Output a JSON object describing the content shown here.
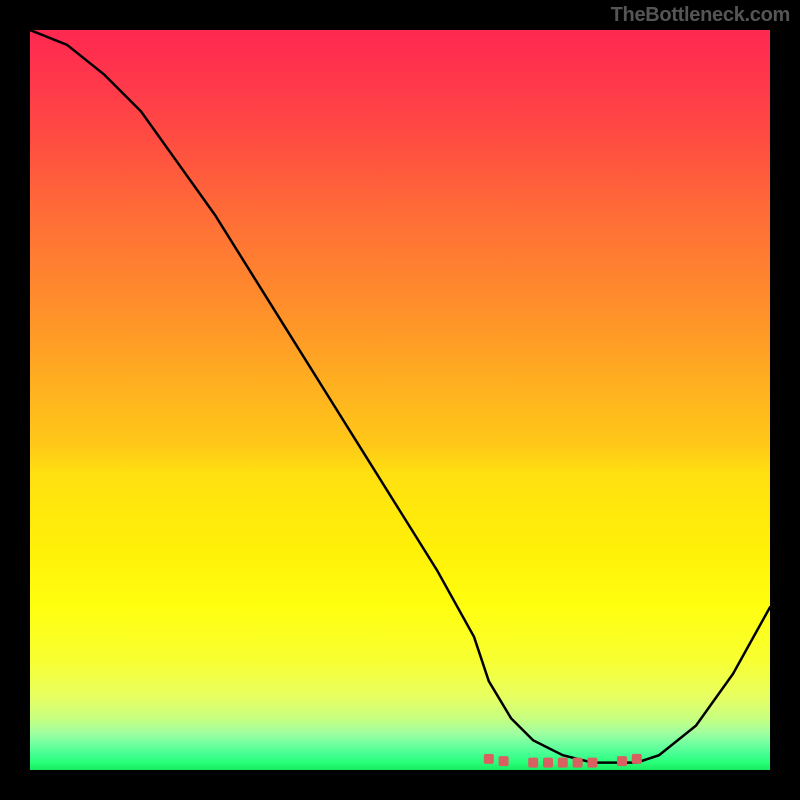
{
  "watermark": "TheBottleneck.com",
  "chart_data": {
    "type": "line",
    "title": "",
    "xlabel": "",
    "ylabel": "",
    "xlim": [
      0,
      100
    ],
    "ylim": [
      0,
      100
    ],
    "grid": false,
    "legend": false,
    "background_gradient": {
      "top": "#ff2850",
      "mid": "#ffff10",
      "bottom": "#18e860"
    },
    "series": [
      {
        "name": "main-curve",
        "color": "#000000",
        "x": [
          0,
          5,
          10,
          15,
          20,
          25,
          30,
          35,
          40,
          45,
          50,
          55,
          60,
          62,
          65,
          68,
          72,
          76,
          80,
          82,
          85,
          90,
          95,
          100
        ],
        "y": [
          100,
          98,
          94,
          89,
          82,
          75,
          67,
          59,
          51,
          43,
          35,
          27,
          18,
          12,
          7,
          4,
          2,
          1,
          1,
          1,
          2,
          6,
          13,
          22
        ]
      },
      {
        "name": "highlight-points",
        "color": "#d86060",
        "style": "scatter",
        "x": [
          62,
          64,
          68,
          70,
          72,
          74,
          76,
          80,
          82
        ],
        "y": [
          1.5,
          1.2,
          1,
          1,
          1,
          1,
          1,
          1.2,
          1.5
        ]
      }
    ]
  }
}
